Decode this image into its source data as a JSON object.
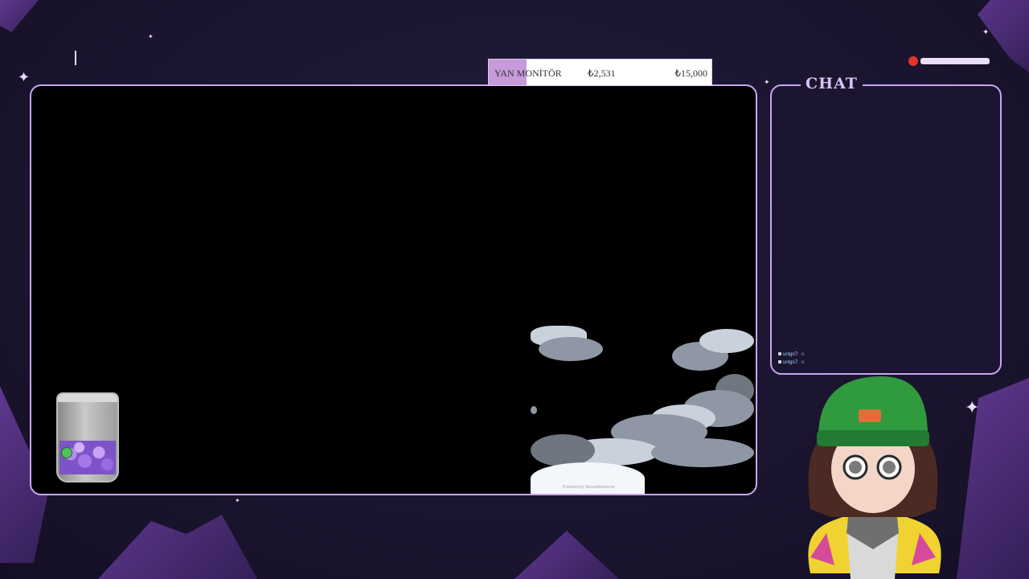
{
  "goal": {
    "label": "YAN MONİTÖR",
    "current": "₺2,531",
    "target": "₺15,000",
    "progress_fraction": 0.169
  },
  "chat": {
    "title": "CHAT",
    "messages": [
      {
        "user": "unlgn7",
        "text": ":"
      },
      {
        "user": "unlgn7",
        "text": ":"
      }
    ]
  },
  "watermark": {
    "text": "Powered by StreamElements"
  },
  "colors": {
    "background": "#1b1530",
    "frame_border": "#c9a6ee",
    "goal_fill": "#c79ad9",
    "crystal": "#6b3fa0"
  },
  "icons": [
    "sparkle-icon",
    "brand-logo-icon",
    "tip-jar-icon"
  ]
}
